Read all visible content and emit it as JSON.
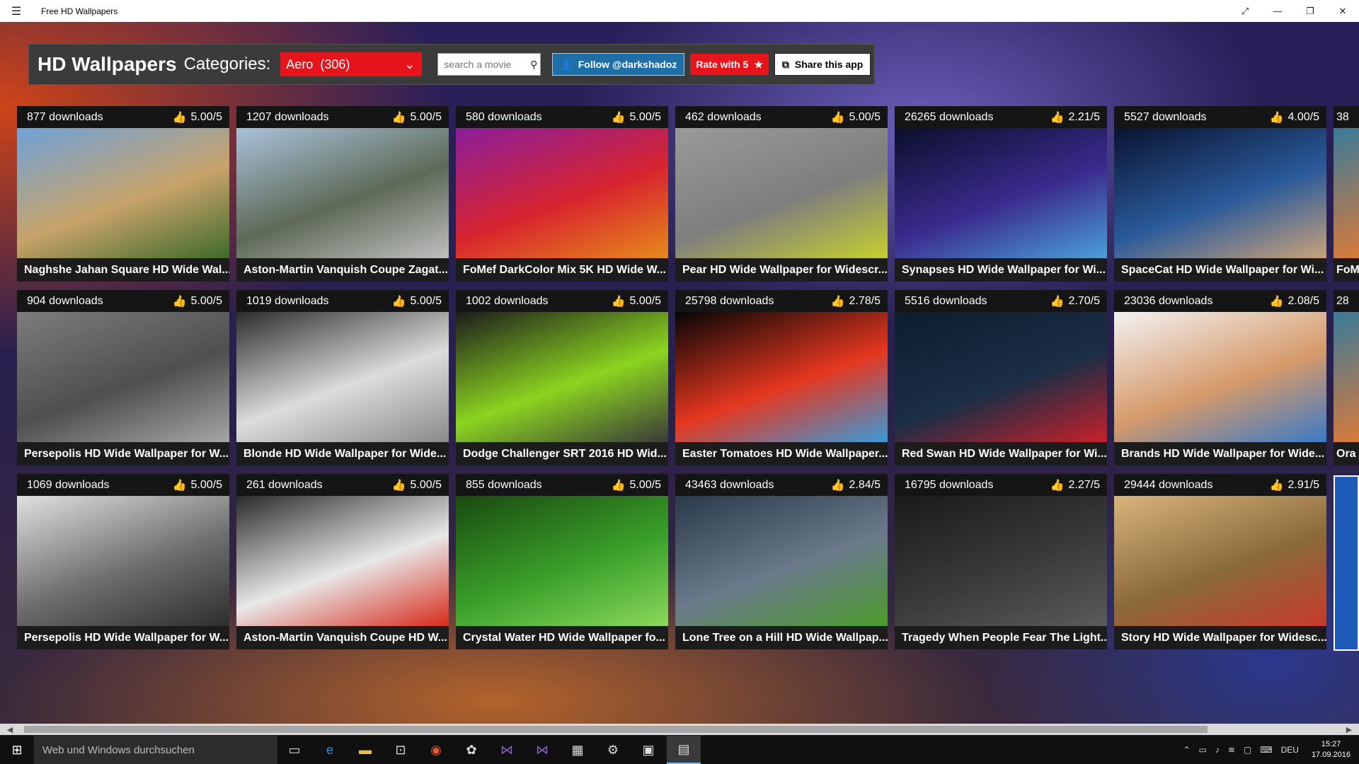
{
  "window": {
    "title": "Free HD Wallpapers",
    "controls": [
      "⤢",
      "—",
      "❐",
      "✕"
    ]
  },
  "header": {
    "app_name": "HD Wallpapers",
    "categories_label": "Categories:",
    "category_selected": "Aero",
    "category_count": "(306)",
    "search_placeholder": "search a movie",
    "follow_label": "Follow @darkshadoz",
    "rate_label": "Rate with 5",
    "share_label": "Share this app"
  },
  "tiles": [
    {
      "downloads": "877 downloads",
      "rating": "5.00/5",
      "caption": "Naghshe Jahan Square HD Wide Wal...",
      "colors": [
        "#6fa2d8",
        "#c8a36a",
        "#3d6a2a"
      ]
    },
    {
      "downloads": "1207 downloads",
      "rating": "5.00/5",
      "caption": "Aston-Martin Vanquish Coupe Zagat...",
      "colors": [
        "#a9c2da",
        "#5e6a57",
        "#bfbfbf"
      ]
    },
    {
      "downloads": "580 downloads",
      "rating": "5.00/5",
      "caption": "FoMef DarkColor Mix 5K HD Wide W...",
      "colors": [
        "#8a1e9c",
        "#d8242e",
        "#e68a1a"
      ]
    },
    {
      "downloads": "462 downloads",
      "rating": "5.00/5",
      "caption": "Pear HD Wide Wallpaper for Widescr...",
      "colors": [
        "#9a9a9a",
        "#7e7e7e",
        "#c6cf2d"
      ]
    },
    {
      "downloads": "26265 downloads",
      "rating": "2.21/5",
      "caption": "Synapses HD Wide Wallpaper for Wi...",
      "colors": [
        "#0b0f2a",
        "#3a2b8e",
        "#4aa0d8"
      ]
    },
    {
      "downloads": "5527 downloads",
      "rating": "4.00/5",
      "caption": "SpaceCat HD Wide Wallpaper for Wi...",
      "colors": [
        "#0a1330",
        "#2a5a9a",
        "#c9a27a"
      ]
    },
    {
      "downloads": "904 downloads",
      "rating": "5.00/5",
      "caption": "Persepolis HD Wide Wallpaper for W...",
      "colors": [
        "#7c7c7c",
        "#4f4f4f",
        "#a6a6a6"
      ]
    },
    {
      "downloads": "1019 downloads",
      "rating": "5.00/5",
      "caption": "Blonde HD Wide Wallpaper for Wide...",
      "colors": [
        "#2c2c2c",
        "#dcdcdc",
        "#8a8a8a"
      ]
    },
    {
      "downloads": "1002 downloads",
      "rating": "5.00/5",
      "caption": "Dodge Challenger SRT 2016 HD Wid...",
      "colors": [
        "#1c1c1c",
        "#8bd41f",
        "#3a3a3a"
      ]
    },
    {
      "downloads": "25798 downloads",
      "rating": "2.78/5",
      "caption": "Easter Tomatoes HD Wide Wallpaper...",
      "colors": [
        "#050505",
        "#e5371f",
        "#3a9ad8"
      ]
    },
    {
      "downloads": "5516 downloads",
      "rating": "2.70/5",
      "caption": "Red Swan HD Wide Wallpaper for Wi...",
      "colors": [
        "#0e1d2e",
        "#1a2e45",
        "#c8202a"
      ]
    },
    {
      "downloads": "23036 downloads",
      "rating": "2.08/5",
      "caption": "Brands HD Wide Wallpaper for Wide...",
      "colors": [
        "#f2f2f2",
        "#d69a6a",
        "#3a7ac8"
      ]
    },
    {
      "downloads": "1069 downloads",
      "rating": "5.00/5",
      "caption": "Persepolis HD Wide Wallpaper for W...",
      "colors": [
        "#e0e0e0",
        "#6e6e6e",
        "#2e2e2e"
      ]
    },
    {
      "downloads": "261 downloads",
      "rating": "5.00/5",
      "caption": "Aston-Martin Vanquish Coupe HD W...",
      "colors": [
        "#2a2a2a",
        "#e8e8e8",
        "#d72a1a"
      ]
    },
    {
      "downloads": "855 downloads",
      "rating": "5.00/5",
      "caption": "Crystal Water HD Wide Wallpaper fo...",
      "colors": [
        "#1a4a10",
        "#3aa02a",
        "#8ad85a"
      ]
    },
    {
      "downloads": "43463 downloads",
      "rating": "2.84/5",
      "caption": "Lone Tree on a Hill HD Wide Wallpap...",
      "colors": [
        "#2a3a4a",
        "#6a7a8a",
        "#4a9a2a"
      ]
    },
    {
      "downloads": "16795 downloads",
      "rating": "2.27/5",
      "caption": "Tragedy When People Fear The Light...",
      "colors": [
        "#1a1a1a",
        "#3a3a3a",
        "#5a5a5a"
      ]
    },
    {
      "downloads": "29444 downloads",
      "rating": "2.91/5",
      "caption": "Story HD Wide Wallpaper for Widesc...",
      "colors": [
        "#d8b47a",
        "#8a6a3a",
        "#c83a2a"
      ]
    }
  ],
  "partial_tiles": [
    {
      "downloads": "38",
      "caption": "FoM"
    },
    {
      "downloads": "28",
      "caption": "Ora"
    },
    {
      "downloads": "",
      "caption": ""
    }
  ],
  "taskbar": {
    "search_placeholder": "Web und Windows durchsuchen",
    "language": "DEU",
    "time": "15:27",
    "date": "17.09.2016"
  }
}
